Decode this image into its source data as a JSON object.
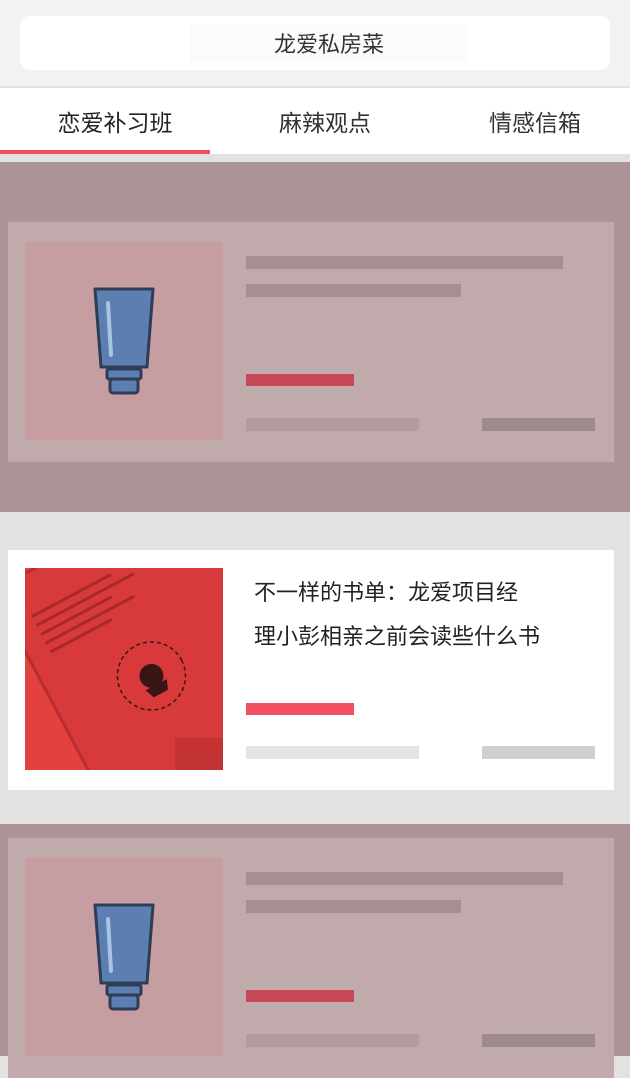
{
  "header": {
    "title": "龙爱私房菜"
  },
  "tabs": [
    {
      "label": "恋爱补习班",
      "active": true
    },
    {
      "label": "麻辣观点",
      "active": false
    },
    {
      "label": "情感信箱",
      "active": false
    }
  ],
  "accent_color": "#ef4f63",
  "articles": [
    {
      "state": "loading",
      "thumbnail_icon": "tube-icon"
    },
    {
      "state": "loaded",
      "title": "不一样的书单：龙爱项目经\n理小彭相亲之前会读些什么书",
      "thumbnail_icon": "red-card-photo"
    },
    {
      "state": "loading",
      "thumbnail_icon": "tube-icon"
    }
  ]
}
